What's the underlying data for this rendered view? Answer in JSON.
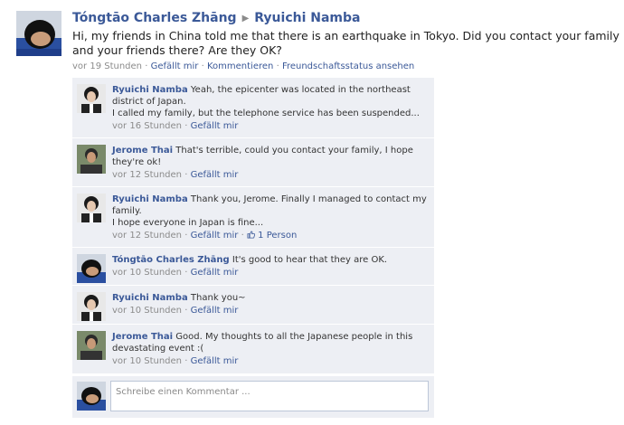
{
  "post": {
    "author": "Tóngtāo Charles Zhāng",
    "arrow": "▶",
    "recipient": "Ryuichi Namba",
    "text": "Hi, my friends in China told me that there is an earthquake in Tokyo. Did you contact your family and your friends there? Are they OK?",
    "time": "vor 19 Stunden",
    "like_label": "Gefällt mir",
    "comment_label": "Kommentieren",
    "friendship_label": "Freundschaftsstatus ansehen"
  },
  "comments": [
    {
      "author": "Ryuichi Namba",
      "text": "Yeah, the epicenter was located in the northeast district of Japan.",
      "text2": "I called my family, but the telephone service has been suspended...",
      "time": "vor 16 Stunden",
      "like_label": "Gefällt mir"
    },
    {
      "author": "Jerome Thai",
      "text": "That's terrible, could you contact your family, I hope they're ok!",
      "time": "vor 12 Stunden",
      "like_label": "Gefällt mir"
    },
    {
      "author": "Ryuichi Namba",
      "text": "Thank you, Jerome. Finally I managed to contact my family.",
      "text2": "I hope everyone in Japan is fine...",
      "time": "vor 12 Stunden",
      "like_label": "Gefällt mir",
      "likes_count": "1 Person"
    },
    {
      "author": "Tóngtāo Charles Zhāng",
      "text": "It's good to hear that they are OK.",
      "time": "vor 10 Stunden",
      "like_label": "Gefällt mir"
    },
    {
      "author": "Ryuichi Namba",
      "text": "Thank you~",
      "time": "vor 10 Stunden",
      "like_label": "Gefällt mir"
    },
    {
      "author": "Jerome Thai",
      "text": "Good. My thoughts to all the Japanese people in this devastating event :(",
      "time": "vor 10 Stunden",
      "like_label": "Gefällt mir"
    }
  ],
  "composer": {
    "placeholder": "Schreibe einen Kommentar ..."
  },
  "separator": "·",
  "icons": {
    "thumb": "thumbs-up-icon"
  },
  "colors": {
    "link": "#3b5998",
    "comment_bg": "#edeff4",
    "meta_gray": "#8b8b8b"
  }
}
